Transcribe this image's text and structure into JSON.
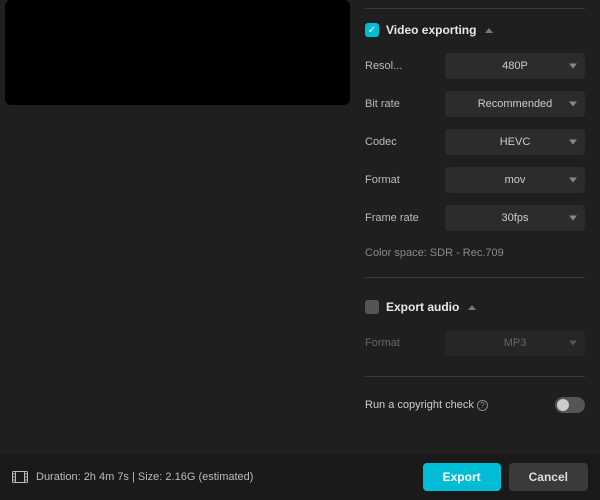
{
  "videoSection": {
    "title": "Video exporting",
    "checked": true,
    "rows": {
      "resolution": {
        "label": "Resol...",
        "value": "480P"
      },
      "bitrate": {
        "label": "Bit rate",
        "value": "Recommended"
      },
      "codec": {
        "label": "Codec",
        "value": "HEVC"
      },
      "format": {
        "label": "Format",
        "value": "mov"
      },
      "framerate": {
        "label": "Frame rate",
        "value": "30fps"
      }
    },
    "colorSpace": "Color space: SDR - Rec.709"
  },
  "audioSection": {
    "title": "Export audio",
    "checked": false,
    "rows": {
      "format": {
        "label": "Format",
        "value": "MP3"
      }
    }
  },
  "copyright": {
    "label": "Run a copyright check",
    "on": false
  },
  "footer": {
    "info": "Duration: 2h 4m 7s | Size: 2.16G (estimated)",
    "export": "Export",
    "cancel": "Cancel"
  },
  "colors": {
    "accent": "#00bcd4"
  }
}
